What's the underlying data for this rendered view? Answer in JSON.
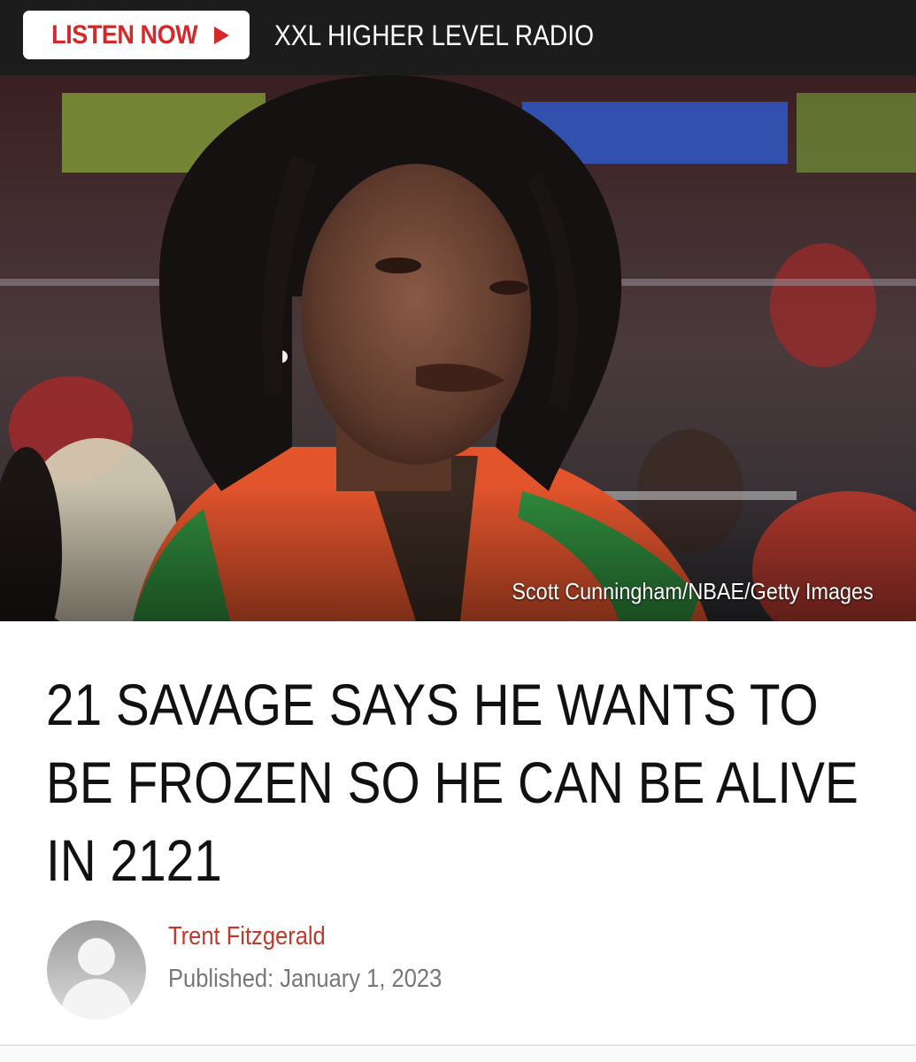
{
  "radio_bar": {
    "listen_label": "LISTEN NOW",
    "station_name": "XXL HIGHER LEVEL RADIO",
    "accent_color": "#d62828"
  },
  "hero": {
    "photo_credit": "Scott Cunningham/NBAE/Getty Images"
  },
  "article": {
    "headline": "21 SAVAGE SAYS HE WANTS TO BE FROZEN SO HE CAN BE ALIVE IN 2121",
    "author": "Trent Fitzgerald",
    "published": "Published: January 1, 2023"
  },
  "icons": {
    "play": "play-triangle-icon",
    "avatar": "default-user-avatar-icon"
  }
}
